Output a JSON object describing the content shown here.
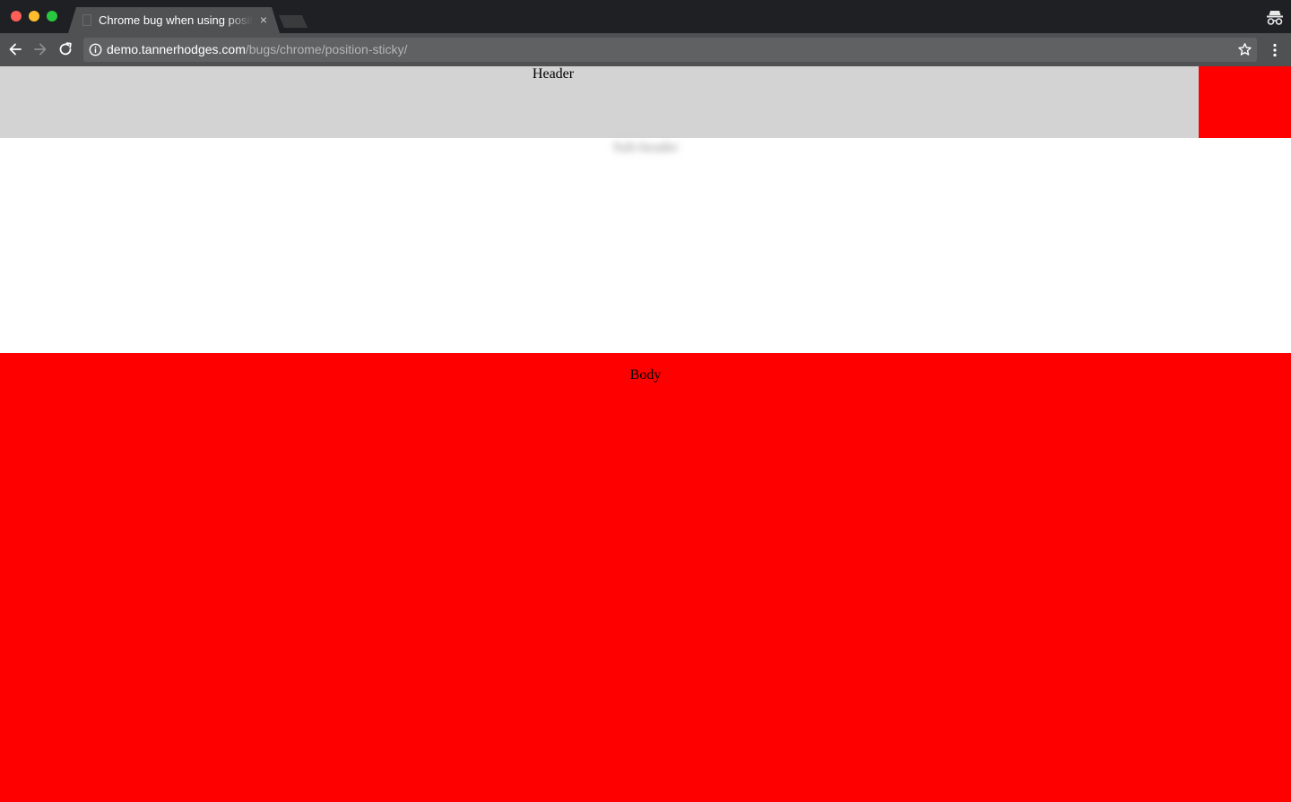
{
  "browser": {
    "tab": {
      "title": "Chrome bug when using position: sticky",
      "close_glyph": "×"
    },
    "address": {
      "host": "demo.tannerhodges.com",
      "path": "/bugs/chrome/position-sticky/"
    },
    "icons": [
      "back-arrow-icon",
      "forward-arrow-icon",
      "reload-icon",
      "info-icon",
      "star-icon",
      "menu-icon",
      "incognito-icon"
    ],
    "colors": {
      "titlebar": "#1f2023",
      "toolbar": "#505153",
      "omnibox": "#606163"
    }
  },
  "page": {
    "header_label": "Header",
    "blurred_label": "Sub-header",
    "body_label": "Body",
    "colors": {
      "header_bg": "#d3d3d3",
      "accent_red": "#ff0000",
      "page_bg": "#ffffff"
    }
  }
}
